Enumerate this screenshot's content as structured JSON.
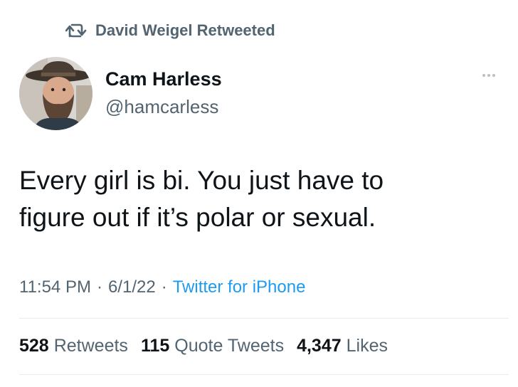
{
  "retweet": {
    "icon": "retweet-icon",
    "label": "David Weigel Retweeted"
  },
  "author": {
    "name": "Cam Harless",
    "handle": "@hamcarless",
    "avatar": "avatar-photo"
  },
  "more_icon": "more-horizontal-icon",
  "tweet": {
    "line1": "Every girl is bi. You just have to",
    "line2": "figure out if it’s polar or sexual."
  },
  "meta": {
    "time": "11:54 PM",
    "sep1": "·",
    "date": "6/1/22",
    "sep2": "·",
    "source": "Twitter for iPhone"
  },
  "stats": {
    "retweets_count": "528",
    "retweets_label": "Retweets",
    "quotes_count": "115",
    "quotes_label": "Quote Tweets",
    "likes_count": "4,347",
    "likes_label": "Likes"
  },
  "colors": {
    "text": "#0f1419",
    "secondary": "#536471",
    "link": "#1d9bf0",
    "divider": "#e6ecf0"
  }
}
